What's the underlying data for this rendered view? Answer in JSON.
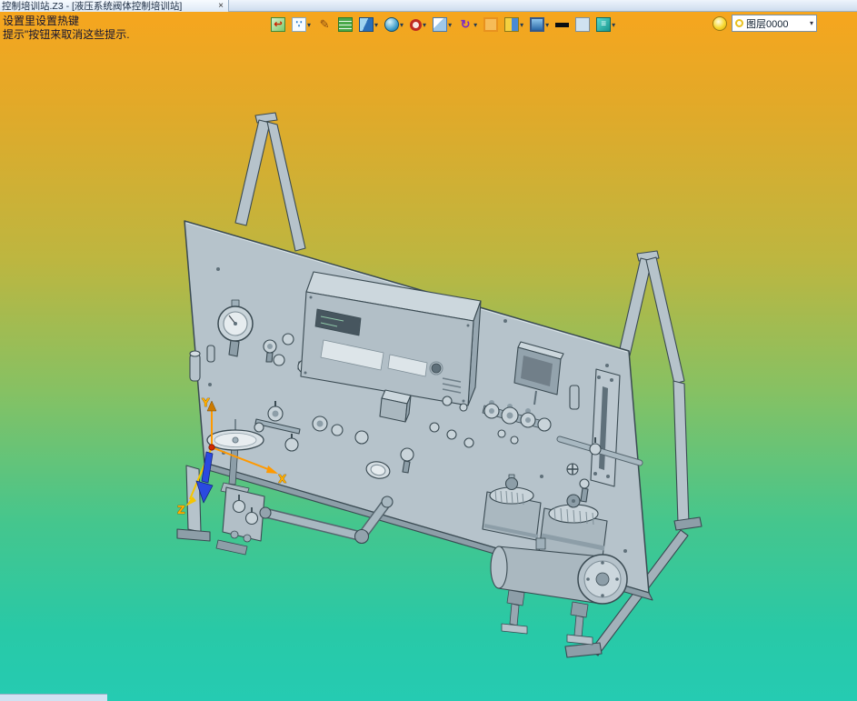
{
  "window": {
    "tab_title": "控制培训站.Z3 - [液压系统阀体控制培训站]",
    "close_glyph": "×"
  },
  "hints": {
    "line1": "设置里设置热键",
    "line2": "提示\"按钮来取消这些提示."
  },
  "toolbar": {
    "dropdown_glyph": "▾",
    "icons": [
      {
        "name": "exit-sketch-icon",
        "glyph": "↩",
        "dropdown": false
      },
      {
        "name": "paint-display-icon",
        "glyph": "∵",
        "dropdown": true
      },
      {
        "name": "measure-pencil-icon",
        "glyph": "✎",
        "dropdown": false
      },
      {
        "name": "layer-book-icon",
        "glyph": "",
        "dropdown": false
      },
      {
        "name": "solid-cube-icon",
        "glyph": "",
        "dropdown": true
      },
      {
        "name": "shaded-sphere-icon",
        "glyph": "",
        "dropdown": true
      },
      {
        "name": "wheel-gear-icon",
        "glyph": "",
        "dropdown": true
      },
      {
        "name": "view-window-icon",
        "glyph": "",
        "dropdown": true
      },
      {
        "name": "rotate-view-icon",
        "glyph": "↻",
        "dropdown": true
      },
      {
        "name": "frame-outline-icon",
        "glyph": "",
        "dropdown": false
      },
      {
        "name": "split-view-icon",
        "glyph": "",
        "dropdown": true
      },
      {
        "name": "monitor-display-icon",
        "glyph": "",
        "dropdown": true
      },
      {
        "name": "line-width-icon",
        "glyph": "",
        "dropdown": false
      },
      {
        "name": "background-color-icon",
        "glyph": "",
        "dropdown": false
      },
      {
        "name": "layer-stack-icon",
        "glyph": "≡",
        "dropdown": true
      }
    ],
    "layer_control": {
      "value": "图层0000",
      "dropdown_glyph": "▾"
    }
  },
  "viewport": {
    "axes": {
      "x": "X",
      "y": "Y",
      "z": "Z"
    }
  },
  "colors": {
    "gradient_top": "#f6a61e",
    "gradient_mid": "#bdb640",
    "gradient_bottom": "#25cbb2",
    "model_gray": "#b6c3cb",
    "model_light": "#ccd7dd",
    "model_dark": "#8d9ea8",
    "model_outline": "#3a4a52",
    "axis_orange": "#ff9900",
    "axis_blue": "#2a4ae0"
  }
}
